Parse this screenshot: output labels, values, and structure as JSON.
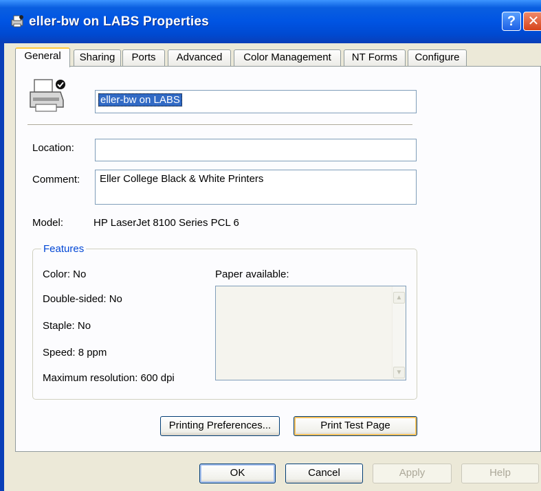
{
  "window": {
    "title": "eller-bw on LABS Properties",
    "help_glyph": "?",
    "close_glyph": "✕"
  },
  "tabs": [
    {
      "label": "General"
    },
    {
      "label": "Sharing"
    },
    {
      "label": "Ports"
    },
    {
      "label": "Advanced"
    },
    {
      "label": "Color Management"
    },
    {
      "label": "NT Forms"
    },
    {
      "label": "Configure"
    }
  ],
  "general": {
    "printer_name": "eller-bw on LABS",
    "location_label": "Location:",
    "location_value": "",
    "comment_label": "Comment:",
    "comment_value": "Eller College Black & White Printers",
    "model_label": "Model:",
    "model_value": "HP LaserJet 8100 Series PCL 6"
  },
  "features": {
    "title": "Features",
    "color": "Color: No",
    "double_sided": "Double-sided: No",
    "staple": "Staple: No",
    "speed": "Speed: 8 ppm",
    "max_resolution": "Maximum resolution: 600 dpi",
    "paper_label": "Paper available:",
    "paper_items": []
  },
  "buttons": {
    "printing_preferences": "Printing Preferences...",
    "print_test_page": "Print Test Page",
    "ok": "OK",
    "cancel": "Cancel",
    "apply": "Apply",
    "help": "Help"
  },
  "colors": {
    "titlebar": "#0054e3",
    "dialog_bg": "#ece9d8",
    "selection": "#316ac5",
    "group_title": "#0046d5"
  }
}
